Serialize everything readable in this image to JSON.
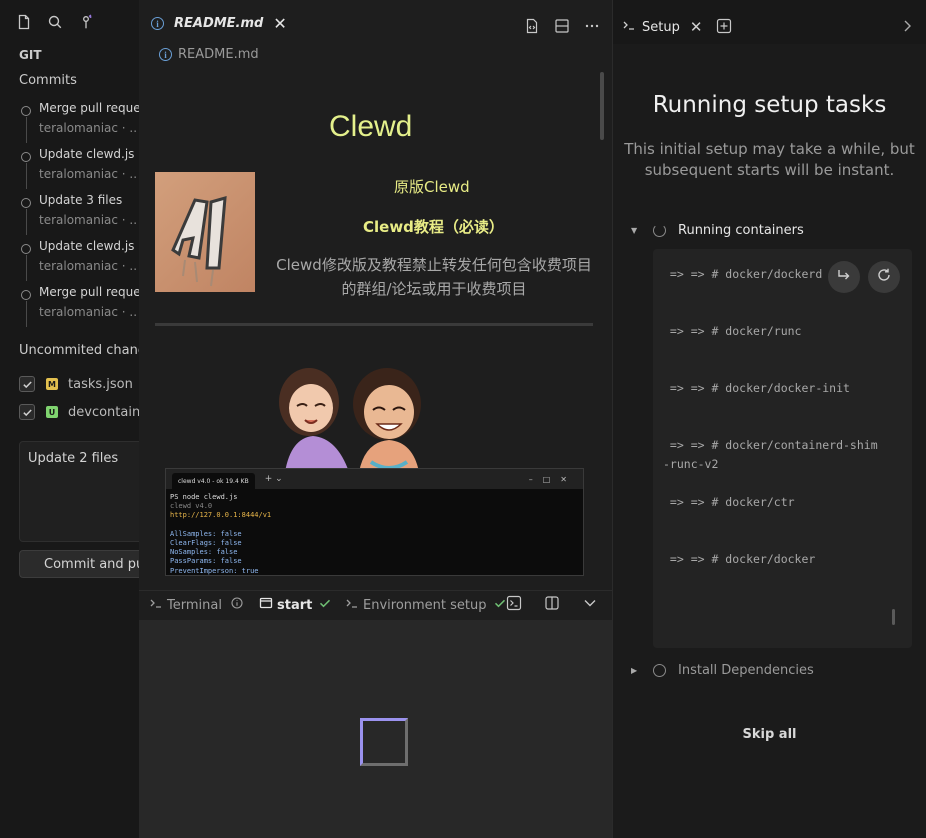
{
  "git_panel": {
    "section_title": "GIT",
    "commits_title": "Commits",
    "commits": [
      {
        "message": "Merge pull reque.",
        "meta": "teralomaniac  ·  .."
      },
      {
        "message": "Update clewd.js .",
        "meta": "teralomaniac  ·  .."
      },
      {
        "message": "Update 3 files",
        "meta": "teralomaniac  ·  .."
      },
      {
        "message": "Update clewd.js",
        "meta": "teralomaniac  ·  .."
      },
      {
        "message": "Merge pull reque.",
        "meta": "teralomaniac  ·  .."
      }
    ],
    "uncommitted_title": "Uncommited chang",
    "files": [
      {
        "badge": "M",
        "badge_color": "#e2c04f",
        "name": "tasks.json"
      },
      {
        "badge": "U",
        "badge_color": "#7fd36f",
        "name": "devcontaine"
      }
    ],
    "commit_message": "Update 2 files",
    "commit_button": "Commit and pu"
  },
  "editor": {
    "tab_label": "README.md",
    "breadcrumb": "README.md",
    "readme": {
      "heading": "Clewd",
      "line1": "原版Clewd",
      "line2": "Clewd教程（必读）",
      "notice": "Clewd修改版及教程禁止转发任何包含收费项目的群组/论坛或用于收费项目"
    },
    "screenshot": {
      "window_tab": "clewd v4.0 - ok 19.4 KB",
      "lines": [
        "PS node clewd.js",
        "clewd v4.0",
        "http://127.0.0.1:8444/v1",
        "",
        "AllSamples: false",
        "ClearFlags: false",
        "NoSamples: false",
        "PassParams: false",
        "PreventImperson: true"
      ]
    }
  },
  "terminal_bar": {
    "terminal_label": "Terminal",
    "start_label": "start",
    "env_label": "Environment setup"
  },
  "setup": {
    "tab_label": "Setup",
    "title": "Running setup tasks",
    "subtitle": "This initial setup may take a while, but subsequent starts will be instant.",
    "running_section": "Running containers",
    "log_lines": [
      " => => # docker/dockerd",
      " => => # docker/runc",
      " => => # docker/docker-init",
      " => => # docker/containerd-shim",
      "-runc-v2",
      " => => # docker/ctr",
      " => => # docker/docker"
    ],
    "install_section": "Install Dependencies",
    "skip_label": "Skip all"
  }
}
